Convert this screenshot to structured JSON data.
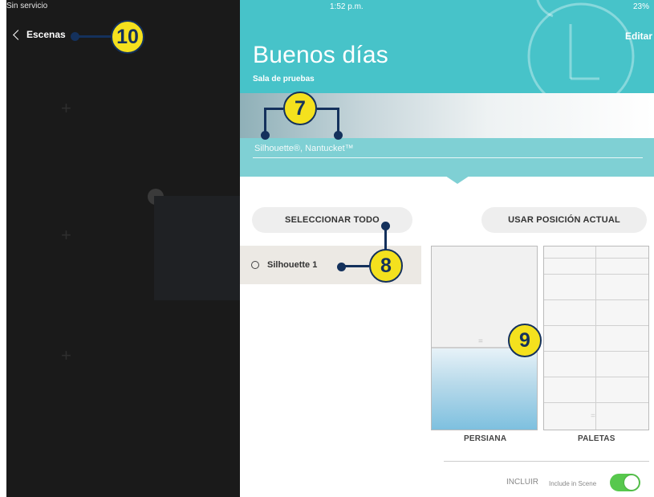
{
  "left_panel": {
    "status": "Sin servicio",
    "back_label": "Escenas"
  },
  "header": {
    "time": "1:52 p.m.",
    "battery": "23%",
    "edit_label": "Editar",
    "title": "Buenos días",
    "room": "Sala de pruebas",
    "products": "Silhouette®, Nantucket™"
  },
  "buttons": {
    "select_all": "SELECCIONAR TODO",
    "use_current": "USAR POSICIÓN ACTUAL"
  },
  "shade_list": [
    {
      "label": "Silhouette 1"
    }
  ],
  "shade_modes": {
    "persiana": "PERSIANA",
    "paletas": "PALETAS"
  },
  "include": {
    "label": "INCLUIR",
    "sub_label": "Include in Scene",
    "enabled": true
  },
  "callouts": [
    "7",
    "8",
    "9",
    "10"
  ],
  "colors": {
    "header": "#47c3c9",
    "callout_fill": "#f4e11e",
    "callout_stroke": "#14315c",
    "toggle_on": "#57c84d"
  }
}
